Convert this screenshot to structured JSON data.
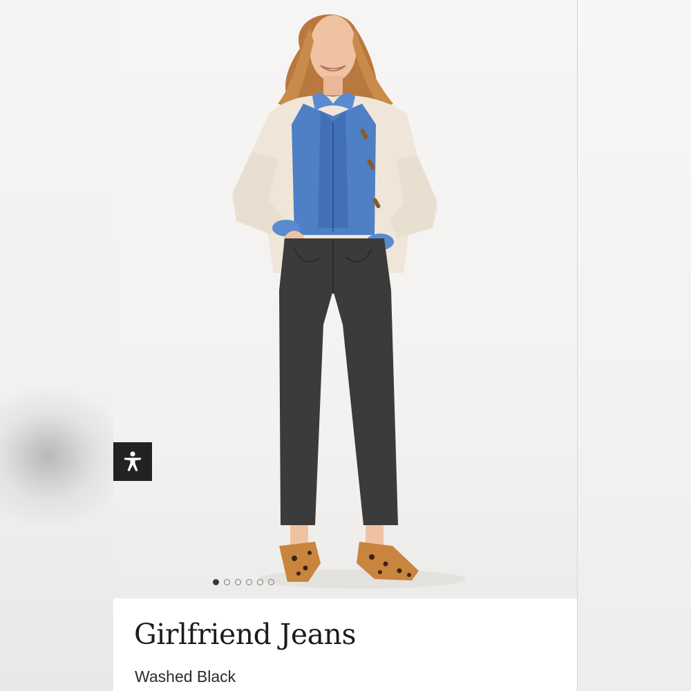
{
  "product": {
    "title": "Girlfriend Jeans",
    "color": "Washed Black"
  },
  "image": {
    "subject": "model wearing cream cardigan, blue denim ruffle shirt, washed black jeans and leopard loafers",
    "carousel_total": 6,
    "carousel_active": 1
  },
  "accessibility": {
    "icon": "accessibility-person-icon"
  },
  "colors": {
    "accessibility_bg": "#222222",
    "title_text": "#1c1c1c",
    "dot_active": "#3a3836"
  }
}
